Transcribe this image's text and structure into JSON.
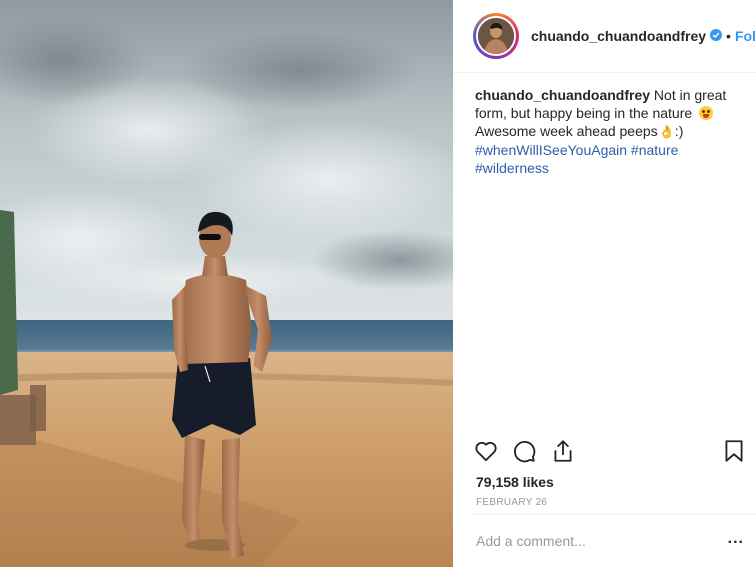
{
  "post": {
    "username": "chuando_chuandoandfrey",
    "follow_label": "Follow",
    "separator": "•",
    "verified_icon": "verified-badge-icon",
    "accent_color": "#3897f0"
  },
  "caption": {
    "username": "chuando_chuandoandfrey",
    "text": "Not in great form, but happy being in the nature",
    "text2": "Awesome week ahead peeps",
    "smile": ":)",
    "hashtags": [
      "#whenWillISeeYouAgain",
      "#nature",
      "#wilderness"
    ]
  },
  "engagement": {
    "likes": "79,158 likes",
    "date": "FEBRUARY 26"
  },
  "comment": {
    "placeholder": "Add a comment...",
    "more_label": "..."
  },
  "icons": [
    "heart-icon",
    "comment-icon",
    "share-icon",
    "bookmark-icon"
  ]
}
